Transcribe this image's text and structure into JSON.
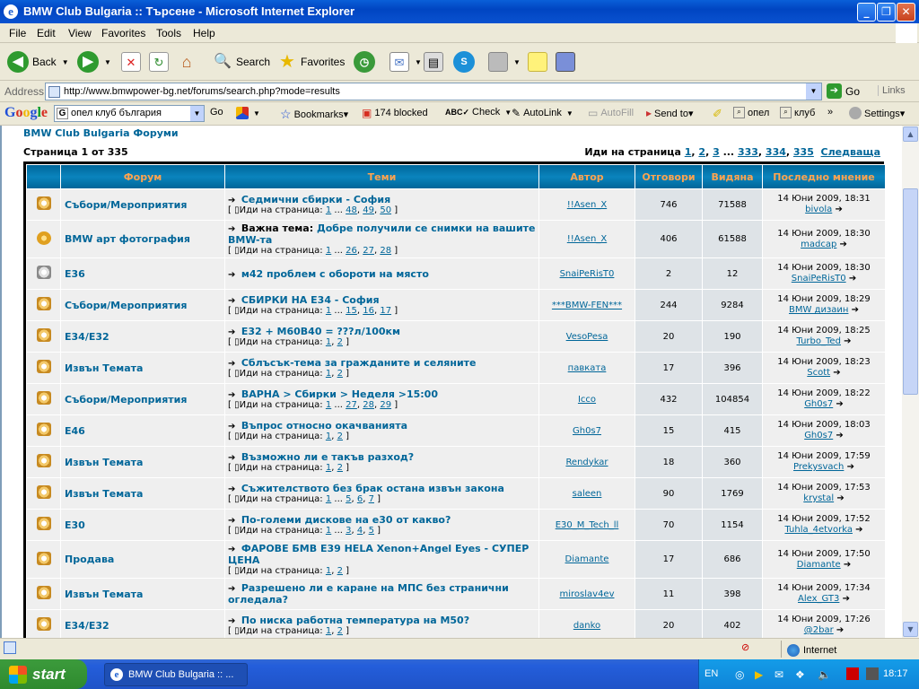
{
  "window": {
    "title": "BMW Club Bulgaria :: Търсене - Microsoft Internet Explorer"
  },
  "menu": [
    "File",
    "Edit",
    "View",
    "Favorites",
    "Tools",
    "Help"
  ],
  "toolbar": {
    "back": "Back",
    "search": "Search",
    "favorites": "Favorites"
  },
  "address": {
    "label": "Address",
    "url": "http://www.bmwpower-bg.net/forums/search.php?mode=results",
    "go": "Go",
    "links": "Links"
  },
  "google": {
    "logo": "Google",
    "query": "опел клуб българия",
    "go": "Go",
    "bookmarks": "Bookmarks▾",
    "blocked": "174 blocked",
    "check": "Check",
    "autolink": "AutoLink",
    "autofill": "AutoFill",
    "sendto": "Send to▾",
    "q1": "опел",
    "q2": "клуб",
    "settings": "Settings▾"
  },
  "page": {
    "crumb": "BMW Club Bulgaria Форуми",
    "pageinfo": "Страница 1 от 335",
    "goto_label": "Иди на страница",
    "goto_pages": [
      "1",
      ", ",
      "2",
      ", ",
      "3",
      " ... ",
      "333",
      ", ",
      "334",
      ", ",
      "335"
    ],
    "next": "Следваща",
    "headers": [
      "Форум",
      "Теми",
      "Автор",
      "Отговори",
      "Видяна",
      "Последно мнение"
    ],
    "gotopage": "Иди на страница:",
    "rows": [
      {
        "forum": "Събори/Мероприятия",
        "icon": "folder",
        "prefix": "",
        "title": "Седмични сбирки - София",
        "pages": [
          "1",
          " ... ",
          "48",
          ", ",
          "49",
          ", ",
          "50"
        ],
        "author": "!!Asen_X",
        "replies": "746",
        "views": "71588",
        "date": "14 Юни 2009, 18:31",
        "last": "bivola"
      },
      {
        "forum": "BMW арт фотография",
        "icon": "sticky",
        "prefix": "Важна тема:",
        "title": "Добре получили се снимки на вашите BMW-та",
        "pages": [
          "1",
          " ... ",
          "26",
          ", ",
          "27",
          ", ",
          "28"
        ],
        "author": "!!Asen_X",
        "replies": "406",
        "views": "61588",
        "date": "14 Юни 2009, 18:30",
        "last": "madcap"
      },
      {
        "forum": "E36",
        "icon": "folder-grey",
        "prefix": "",
        "title": "м42 проблем с оборoти на място",
        "pages": [],
        "author": "SnaiPeRisT0",
        "replies": "2",
        "views": "12",
        "date": "14 Юни 2009, 18:30",
        "last": "SnaiPeRisT0"
      },
      {
        "forum": "Събори/Мероприятия",
        "icon": "folder",
        "prefix": "",
        "title": "СБИРКИ НА E34 - София",
        "pages": [
          "1",
          " ... ",
          "15",
          ", ",
          "16",
          ", ",
          "17"
        ],
        "author": "***BMW-FEN***",
        "replies": "244",
        "views": "9284",
        "date": "14 Юни 2009, 18:29",
        "last": "BMW дизаин"
      },
      {
        "forum": "E34/E32",
        "icon": "folder",
        "prefix": "",
        "title": "E32 + M60B40 = ???л/100км",
        "pages": [
          "1",
          ", ",
          "2"
        ],
        "author": "VesoPesa",
        "replies": "20",
        "views": "190",
        "date": "14 Юни 2009, 18:25",
        "last": "Turbo_Ted"
      },
      {
        "forum": "Извън Темата",
        "icon": "folder",
        "prefix": "",
        "title": "Сблъсък-тема за гражданите и селяните",
        "pages": [
          "1",
          ", ",
          "2"
        ],
        "author": "павката",
        "replies": "17",
        "views": "396",
        "date": "14 Юни 2009, 18:23",
        "last": "Scott"
      },
      {
        "forum": "Събори/Мероприятия",
        "icon": "folder",
        "prefix": "",
        "title": "ВАРНА > Сбирки > Неделя >15:00",
        "pages": [
          "1",
          " ... ",
          "27",
          ", ",
          "28",
          ", ",
          "29"
        ],
        "author": "Icco",
        "replies": "432",
        "views": "104854",
        "date": "14 Юни 2009, 18:22",
        "last": "Gh0s7"
      },
      {
        "forum": "E46",
        "icon": "folder",
        "prefix": "",
        "title": "Въпрос относно окачванията",
        "pages": [
          "1",
          ", ",
          "2"
        ],
        "author": "Gh0s7",
        "replies": "15",
        "views": "415",
        "date": "14 Юни 2009, 18:03",
        "last": "Gh0s7"
      },
      {
        "forum": "Извън Темата",
        "icon": "folder",
        "prefix": "",
        "title": "Възможно ли е такъв разход?",
        "pages": [
          "1",
          ", ",
          "2"
        ],
        "author": "Rendykar",
        "replies": "18",
        "views": "360",
        "date": "14 Юни 2009, 17:59",
        "last": "Prekysvach"
      },
      {
        "forum": "Извън Темата",
        "icon": "folder",
        "prefix": "",
        "title": "Съжителството без брак остана извън закона",
        "pages": [
          "1",
          " ... ",
          "5",
          ", ",
          "6",
          ", ",
          "7"
        ],
        "author": "saleen",
        "replies": "90",
        "views": "1769",
        "date": "14 Юни 2009, 17:53",
        "last": "krystal"
      },
      {
        "forum": "E30",
        "icon": "folder",
        "prefix": "",
        "title": "По-големи дискове на е30 от какво?",
        "pages": [
          "1",
          " ... ",
          "3",
          ", ",
          "4",
          ", ",
          "5"
        ],
        "author": "E30_M_Tech_ll",
        "replies": "70",
        "views": "1154",
        "date": "14 Юни 2009, 17:52",
        "last": "Tuhla_4etvorka"
      },
      {
        "forum": "Продава",
        "icon": "folder",
        "prefix": "",
        "title": "ФАРОВЕ БМВ Е39 HELA Xenon+Angel Eyes - СУПЕР ЦЕНА",
        "pages": [
          "1",
          ", ",
          "2"
        ],
        "author": "Diamante",
        "replies": "17",
        "views": "686",
        "date": "14 Юни 2009, 17:50",
        "last": "Diamante"
      },
      {
        "forum": "Извън Темата",
        "icon": "folder",
        "prefix": "",
        "title": "Разрешено ли е каране на МПС без странични огледала?",
        "pages": [],
        "author": "miroslav4ev",
        "replies": "11",
        "views": "398",
        "date": "14 Юни 2009, 17:34",
        "last": "Alex_GT3"
      },
      {
        "forum": "E34/E32",
        "icon": "folder",
        "prefix": "",
        "title": "По ниска работна температура на М50?",
        "pages": [
          "1",
          ", ",
          "2"
        ],
        "author": "danko",
        "replies": "20",
        "views": "402",
        "date": "14 Юни 2009, 17:26",
        "last": "@2bar"
      }
    ]
  },
  "status": {
    "zone": "Internet"
  },
  "taskbar": {
    "start": "start",
    "item": "BMW Club Bulgaria :: ...",
    "lang": "EN",
    "time": "18:17"
  }
}
